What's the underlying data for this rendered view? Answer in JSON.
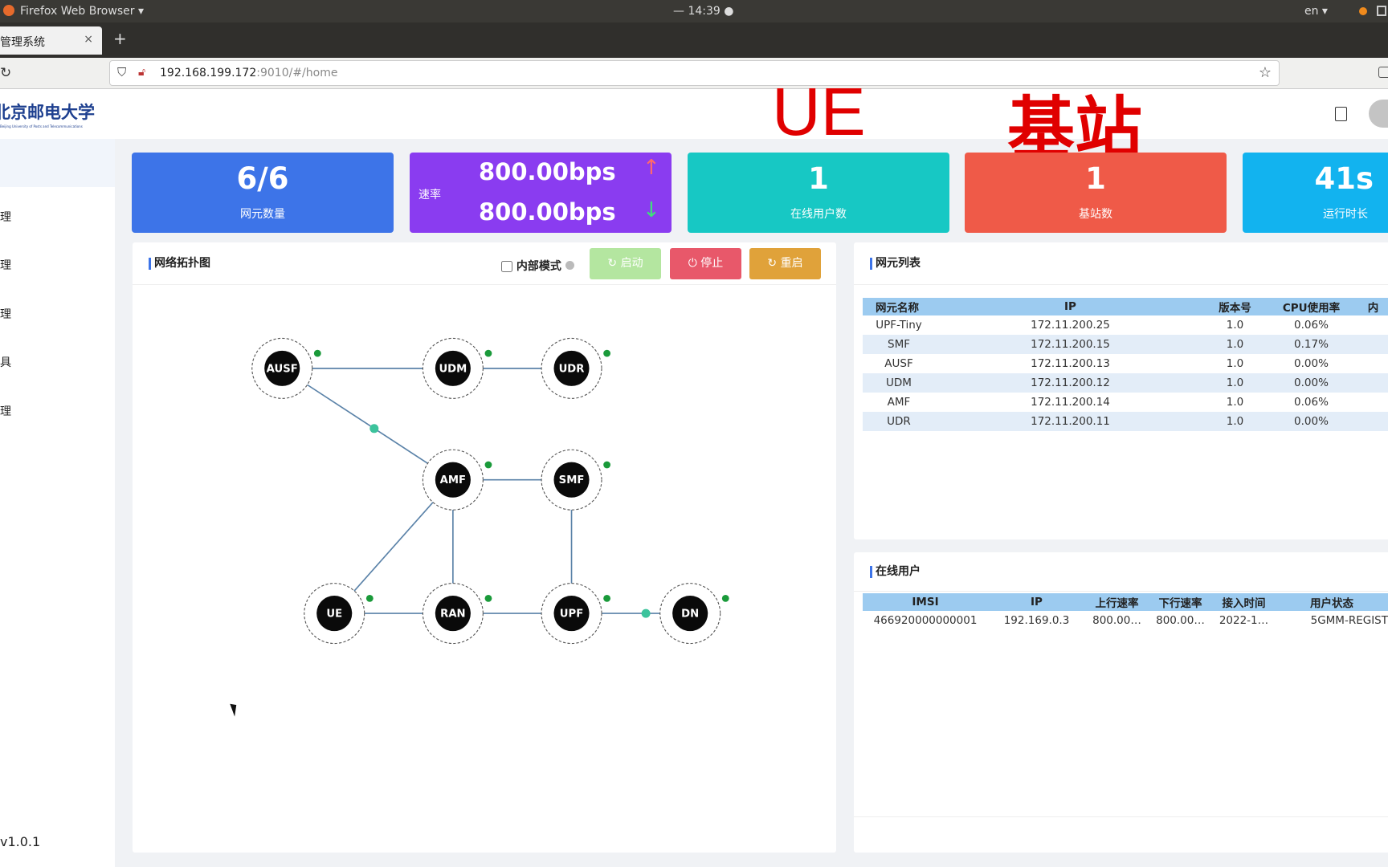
{
  "system_bar": {
    "app": "Firefox Web Browser ▾",
    "clock": "— 14:39 ●",
    "lang": "en ▾"
  },
  "browser": {
    "tab_title": "管理系统",
    "tab_close": "×",
    "new_tab": "+",
    "url_host": "192.168.199.172",
    "url_rest": ":9010/#/home"
  },
  "header": {
    "logo_text": "北京邮电大学",
    "logo_sub": "Beijing University of Posts and Telecommunications",
    "overlay_ue": "UE",
    "overlay_bs": "基站"
  },
  "sidebar": {
    "items": [
      {
        "label": "理"
      },
      {
        "label": "理"
      },
      {
        "label": "理"
      },
      {
        "label": "具"
      },
      {
        "label": "理"
      }
    ],
    "version": "v1.0.1"
  },
  "stats": [
    {
      "value": "6/6",
      "label": "网元数量",
      "color": "#3d74e8"
    },
    {
      "label": "速率",
      "up": "800.00bps",
      "down": "800.00bps",
      "color": "#8a3cf0"
    },
    {
      "value": "1",
      "label": "在线用户数",
      "color": "#17c8c4"
    },
    {
      "value": "1",
      "label": "基站数",
      "color": "#ef5a48"
    },
    {
      "value": "41s",
      "label": "运行时长",
      "color": "#12b3ef"
    }
  ],
  "topology": {
    "title": "网络拓扑图",
    "internal_mode": "内部模式",
    "internal_checked": false,
    "buttons": {
      "start": "启动",
      "stop": "停止",
      "restart": "重启"
    },
    "nodes": [
      "AUSF",
      "UDM",
      "UDR",
      "AMF",
      "SMF",
      "UE",
      "RAN",
      "UPF",
      "DN"
    ],
    "edges": [
      [
        "AUSF",
        "UDM"
      ],
      [
        "UDM",
        "UDR"
      ],
      [
        "AUSF",
        "AMF"
      ],
      [
        "AMF",
        "SMF"
      ],
      [
        "AMF",
        "UE"
      ],
      [
        "AMF",
        "RAN"
      ],
      [
        "SMF",
        "UPF"
      ],
      [
        "UE",
        "RAN"
      ],
      [
        "RAN",
        "UPF"
      ],
      [
        "UPF",
        "DN"
      ]
    ]
  },
  "nf_list": {
    "title": "网元列表",
    "columns": [
      "网元名称",
      "IP",
      "版本号",
      "CPU使用率",
      "内"
    ],
    "rows": [
      [
        "UPF-Tiny",
        "172.11.200.25",
        "1.0",
        "0.06%"
      ],
      [
        "SMF",
        "172.11.200.15",
        "1.0",
        "0.17%"
      ],
      [
        "AUSF",
        "172.11.200.13",
        "1.0",
        "0.00%"
      ],
      [
        "UDM",
        "172.11.200.12",
        "1.0",
        "0.00%"
      ],
      [
        "AMF",
        "172.11.200.14",
        "1.0",
        "0.06%"
      ],
      [
        "UDR",
        "172.11.200.11",
        "1.0",
        "0.00%"
      ]
    ]
  },
  "online_users": {
    "title": "在线用户",
    "columns": [
      "IMSI",
      "IP",
      "上行速率",
      "下行速率",
      "接入时间",
      "用户状态"
    ],
    "rows": [
      [
        "466920000000001",
        "192.169.0.3",
        "800.00…",
        "800.00…",
        "2022-1…",
        "5GMM-REGIST"
      ]
    ]
  }
}
